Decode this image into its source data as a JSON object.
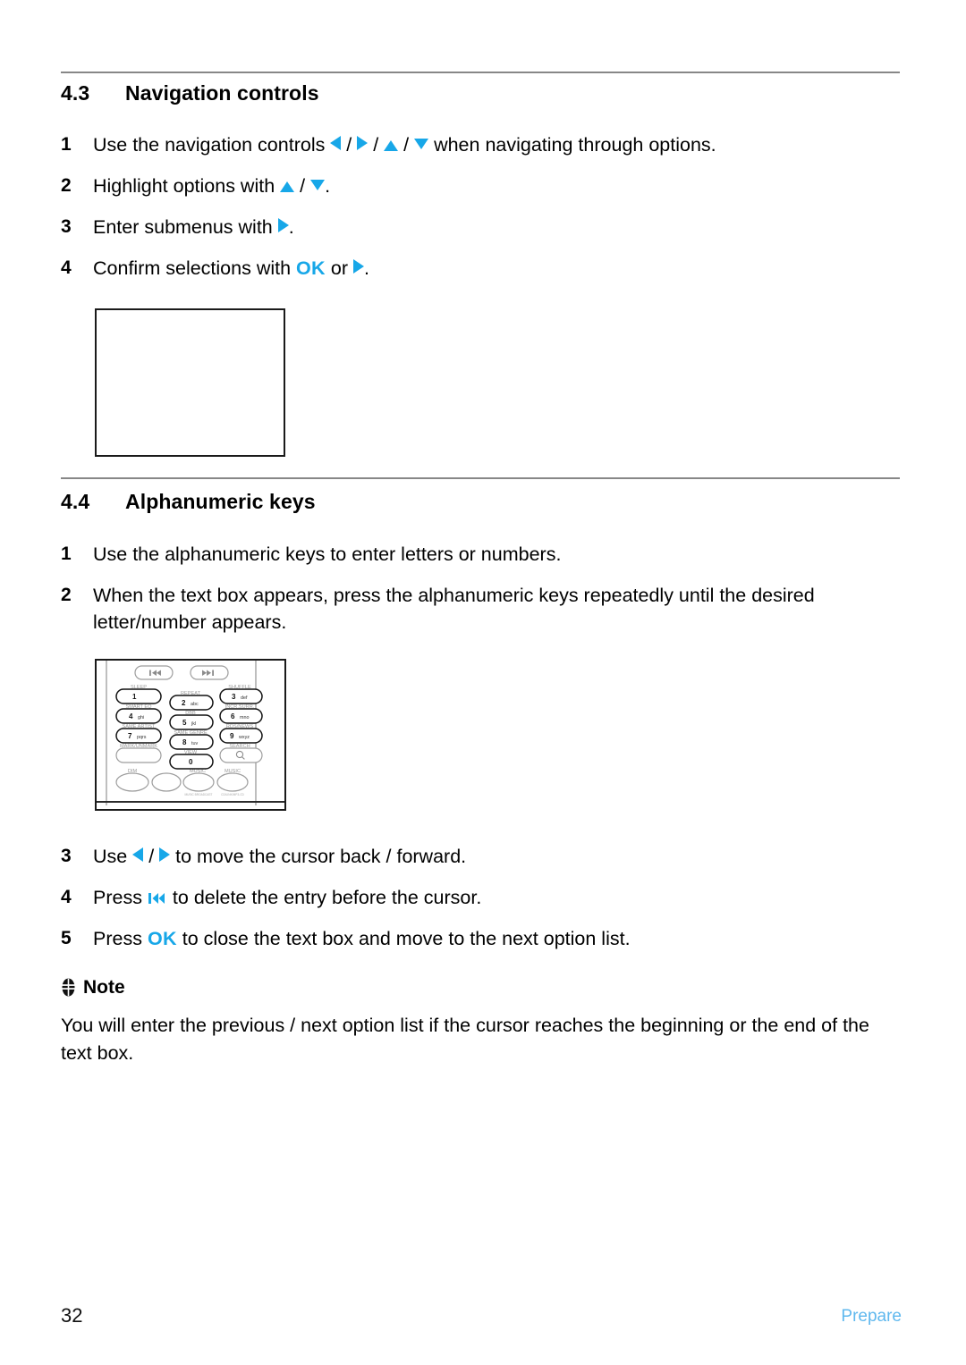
{
  "accent_color": "#17A7E8",
  "footer_color": "#5FB8EE",
  "rule_color": "#878787",
  "sections": [
    {
      "number": "4.3",
      "title": "Navigation controls",
      "steps": [
        {
          "index": "1",
          "parts": [
            {
              "type": "text",
              "value": "Use the navigation controls "
            },
            {
              "type": "icon",
              "value": "triangle-left-icon"
            },
            {
              "type": "text",
              "value": " / "
            },
            {
              "type": "icon",
              "value": "triangle-right-icon"
            },
            {
              "type": "text",
              "value": " / "
            },
            {
              "type": "icon",
              "value": "triangle-up-icon"
            },
            {
              "type": "text",
              "value": " / "
            },
            {
              "type": "icon",
              "value": "triangle-down-icon"
            },
            {
              "type": "text",
              "value": " when navigating through options."
            }
          ],
          "plain": "Use the navigation controls ◀ / ▶ / ▲ / ▼ when navigating through options."
        },
        {
          "index": "2",
          "plain": "Highlight options with ▲ / ▼."
        },
        {
          "index": "3",
          "plain": "Enter submenus with ▶."
        },
        {
          "index": "4",
          "plain": "Confirm selections with OK or ▶."
        }
      ]
    },
    {
      "number": "4.4",
      "title": "Alphanumeric keys",
      "steps": [
        {
          "index": "1",
          "plain": "Use the alphanumeric keys to enter letters or numbers."
        },
        {
          "index": "2",
          "plain": "When the text box appears, press the alphanumeric keys repeatedly until the desired letter/number appears."
        },
        {
          "index": "3",
          "plain": "Use ◀ / ▶ to move the cursor back / forward."
        },
        {
          "index": "4",
          "plain": "Press ⏮ to delete the entry before the cursor."
        },
        {
          "index": "5",
          "plain": "Press OK to close the text box and move to the next option list."
        }
      ]
    }
  ],
  "step_text": {
    "s43_1_a": "Use the navigation controls ",
    "s43_1_b": " when navigating through options.",
    "s43_2_a": "Highlight options with ",
    "s43_2_b": ".",
    "s43_3_a": "Enter submenus with ",
    "s43_3_b": ".",
    "s43_4_a": "Confirm selections with ",
    "s43_4_ok": "OK",
    "s43_4_b": " or ",
    "s43_4_c": ".",
    "s44_1": "Use the alphanumeric keys to enter letters or numbers.",
    "s44_2": "When the text box appears, press the alphanumeric keys repeatedly until the desired letter/number appears.",
    "s44_3_a": "Use ",
    "s44_3_mid": " / ",
    "s44_3_b": " to move the cursor back / forward.",
    "s44_4_a": "Press ",
    "s44_4_b": " to delete the entry before the cursor.",
    "s44_5_a": "Press ",
    "s44_5_ok": "OK",
    "s44_5_b": " to close the text box and move to the next option list.",
    "slash": " / "
  },
  "note": {
    "icon": "note-book-icon",
    "heading": "Note",
    "body": "You will enter the previous / next option list if the cursor reaches the beginning or the end of the text box."
  },
  "figures": {
    "navigation_placeholder": {
      "name": "empty-illustration-frame",
      "caption": ""
    },
    "remote_keypad": {
      "name": "remote-control-alphanumeric-keypad",
      "top_keys": [
        "prev-track-icon",
        "next-track-icon"
      ],
      "rows": [
        [
          {
            "label": "SLEEP",
            "key": "1",
            "letters": "",
            "highlight": true
          },
          {
            "label": "REPEAT",
            "key": "2",
            "letters": "abc",
            "highlight": true
          },
          {
            "label": "SHUFFLE",
            "key": "3",
            "letters": "def",
            "highlight": true
          }
        ],
        [
          {
            "label": "SMART EQ",
            "key": "4",
            "letters": "ghi",
            "highlight": true
          },
          {
            "label": "DBB",
            "key": "5",
            "letters": "jkl",
            "highlight": true
          },
          {
            "label": "INCR.SURR.",
            "key": "6",
            "letters": "mno",
            "highlight": true
          }
        ],
        [
          {
            "label": "SAME ARTIST",
            "key": "7",
            "letters": "pqrs",
            "highlight": true
          },
          {
            "label": "SAME GENRE",
            "key": "8",
            "letters": "tuv",
            "highlight": true
          },
          {
            "label": "RDS/NEWS",
            "key": "9",
            "letters": "wxyz",
            "highlight": true
          }
        ],
        [
          {
            "label": "MARK/UNMARK",
            "key": "",
            "letters": "",
            "highlight": false
          },
          {
            "label": "VIEW",
            "key": "0",
            "letters": "",
            "highlight": true
          },
          {
            "label": "SEARCH",
            "key": "search-icon",
            "letters": "",
            "highlight": false
          }
        ],
        [
          {
            "label": "DIM",
            "key": "",
            "letters": "",
            "highlight": false
          },
          {
            "label": "",
            "key": "",
            "letters": "",
            "highlight": false
          },
          {
            "label": "MUSIC",
            "key": "",
            "letters": "",
            "highlight": false
          },
          {
            "label": "MUSIC",
            "key": "",
            "letters": "",
            "highlight": false
          }
        ]
      ]
    }
  },
  "footer": {
    "page_number": "32",
    "section_label": "Prepare"
  }
}
